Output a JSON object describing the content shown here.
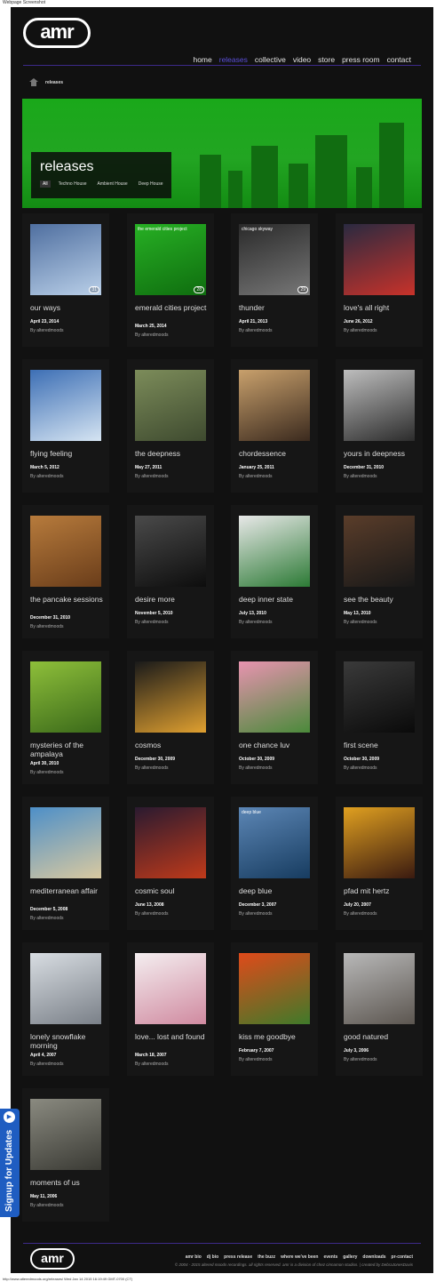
{
  "window": {
    "title": "Webpage Screenshot"
  },
  "brand": {
    "logo_text": "amr"
  },
  "nav": {
    "items": [
      {
        "label": "home",
        "active": false
      },
      {
        "label": "releases",
        "active": true
      },
      {
        "label": "collective",
        "active": false
      },
      {
        "label": "video",
        "active": false
      },
      {
        "label": "store",
        "active": false
      },
      {
        "label": "press room",
        "active": false
      },
      {
        "label": "contact",
        "active": false
      }
    ]
  },
  "breadcrumb": {
    "current": "releases",
    "icon": "home-icon"
  },
  "hero": {
    "title": "releases",
    "filters": [
      {
        "label": "All",
        "active": true
      },
      {
        "label": "Techno House",
        "active": false
      },
      {
        "label": "Ambient House",
        "active": false
      },
      {
        "label": "Deep House",
        "active": false
      }
    ]
  },
  "releases": [
    {
      "title": "our ways",
      "date": "April 23, 2014",
      "by": "By alteredmoods",
      "colors": [
        "#4f6fa0",
        "#b9cfe8"
      ],
      "caption": "",
      "number": "31"
    },
    {
      "title": "emerald cities project",
      "date": "March 25, 2014",
      "by": "By alteredmoods",
      "colors": [
        "#27b024",
        "#0f6d0f"
      ],
      "caption": "the emerald cities project",
      "number": "28"
    },
    {
      "title": "thunder",
      "date": "April 21, 2013",
      "by": "By alteredmoods",
      "colors": [
        "#2a2a2a",
        "#777"
      ],
      "caption": "chicago skyway",
      "number": "29"
    },
    {
      "title": "love's all right",
      "date": "June 26, 2012",
      "by": "By alteredmoods",
      "colors": [
        "#2a2a40",
        "#c8322a"
      ],
      "caption": "",
      "number": ""
    },
    {
      "title": "flying feeling",
      "date": "March 5, 2012",
      "by": "By alteredmoods",
      "colors": [
        "#3d6fb5",
        "#d5e4f2"
      ],
      "caption": "",
      "number": ""
    },
    {
      "title": "the deepness",
      "date": "May 27, 2011",
      "by": "By alteredmoods",
      "colors": [
        "#7c8c5a",
        "#3e4a2f"
      ],
      "caption": "",
      "number": ""
    },
    {
      "title": "chordessence",
      "date": "January 25, 2011",
      "by": "By alteredmoods",
      "colors": [
        "#c8a06c",
        "#3b2a1e"
      ],
      "caption": "",
      "number": ""
    },
    {
      "title": "yours in deepness",
      "date": "December 31, 2010",
      "by": "By alteredmoods",
      "colors": [
        "#bdbdbd",
        "#2c2c2c"
      ],
      "caption": "",
      "number": ""
    },
    {
      "title": "the pancake sessions",
      "date": "December 31, 2010",
      "by": "By alteredmoods",
      "colors": [
        "#b77b3c",
        "#6a3d1a"
      ],
      "caption": "",
      "number": ""
    },
    {
      "title": "desire more",
      "date": "November 5, 2010",
      "by": "By alteredmoods",
      "colors": [
        "#4a4a4a",
        "#0d0d0d"
      ],
      "caption": "",
      "number": ""
    },
    {
      "title": "deep inner state",
      "date": "July 13, 2010",
      "by": "By alteredmoods",
      "colors": [
        "#e8e8e8",
        "#2c7a35"
      ],
      "caption": "",
      "number": ""
    },
    {
      "title": "see the beauty",
      "date": "May 13, 2010",
      "by": "By alteredmoods",
      "colors": [
        "#5a3d2a",
        "#181818"
      ],
      "caption": "",
      "number": ""
    },
    {
      "title": "mysteries of the ampalaya",
      "date": "April 30, 2010",
      "by": "By alteredmoods",
      "colors": [
        "#8ebf3a",
        "#3b6a1a"
      ],
      "caption": "",
      "number": ""
    },
    {
      "title": "cosmos",
      "date": "December 30, 2009",
      "by": "By alteredmoods",
      "colors": [
        "#1a1a1a",
        "#e0a030"
      ],
      "caption": "",
      "number": ""
    },
    {
      "title": "one chance luv",
      "date": "October 30, 2009",
      "by": "By alteredmoods",
      "colors": [
        "#e893b0",
        "#4a8a3a"
      ],
      "caption": "",
      "number": ""
    },
    {
      "title": "first scene",
      "date": "October 30, 2009",
      "by": "By alteredmoods",
      "colors": [
        "#3a3a3a",
        "#0a0a0a"
      ],
      "caption": "",
      "number": ""
    },
    {
      "title": "mediterranean affair",
      "date": "December 5, 2008",
      "by": "By alteredmoods",
      "colors": [
        "#4d8fc8",
        "#d9c9a0"
      ],
      "caption": "",
      "number": ""
    },
    {
      "title": "cosmic soul",
      "date": "June 13, 2008",
      "by": "By alteredmoods",
      "colors": [
        "#2a1a30",
        "#c03a1a"
      ],
      "caption": "",
      "number": ""
    },
    {
      "title": "deep blue",
      "date": "December 3, 2007",
      "by": "By alteredmoods",
      "colors": [
        "#5c86b5",
        "#173c60"
      ],
      "caption": "deep blue",
      "number": ""
    },
    {
      "title": "pfad mit hertz",
      "date": "July 20, 2007",
      "by": "By alteredmoods",
      "colors": [
        "#e0a020",
        "#3a1a10"
      ],
      "caption": "",
      "number": ""
    },
    {
      "title": "lonely snowflake morning",
      "date": "April 4, 2007",
      "by": "By alteredmoods",
      "colors": [
        "#d8dde2",
        "#7a8088"
      ],
      "caption": "",
      "number": ""
    },
    {
      "title": "love... lost and found",
      "date": "March 18, 2007",
      "by": "By alteredmoods",
      "colors": [
        "#f4eef0",
        "#d08aa0"
      ],
      "caption": "",
      "number": ""
    },
    {
      "title": "kiss me goodbye",
      "date": "February 7, 2007",
      "by": "By alteredmoods",
      "colors": [
        "#e04a1a",
        "#3f7a2a"
      ],
      "caption": "",
      "number": ""
    },
    {
      "title": "good natured",
      "date": "July 3, 2006",
      "by": "By alteredmoods",
      "colors": [
        "#b8b8b8",
        "#5c5650"
      ],
      "caption": "",
      "number": ""
    },
    {
      "title": "moments of us",
      "date": "May 11, 2006",
      "by": "By alteredmoods",
      "colors": [
        "#8a8a80",
        "#3a3a34"
      ],
      "caption": "",
      "number": ""
    }
  ],
  "signup": {
    "label": "Signup for Updates"
  },
  "footer": {
    "links": [
      "amr bio",
      "dj bio",
      "press release",
      "the buzz",
      "where we've been",
      "events",
      "gallery",
      "downloads",
      "pr-contact"
    ],
    "copyright": "© 2004 - 2015 altered moods recordings. all rights reserved. amr is a division of chez cinnamon studios. | created by DebraJonesDavis"
  },
  "status_bar": {
    "text": "http://www.alteredmoods.org/releases/ Wed Jan 14 2015 16:19:49 GMT-0700 (CT)"
  }
}
